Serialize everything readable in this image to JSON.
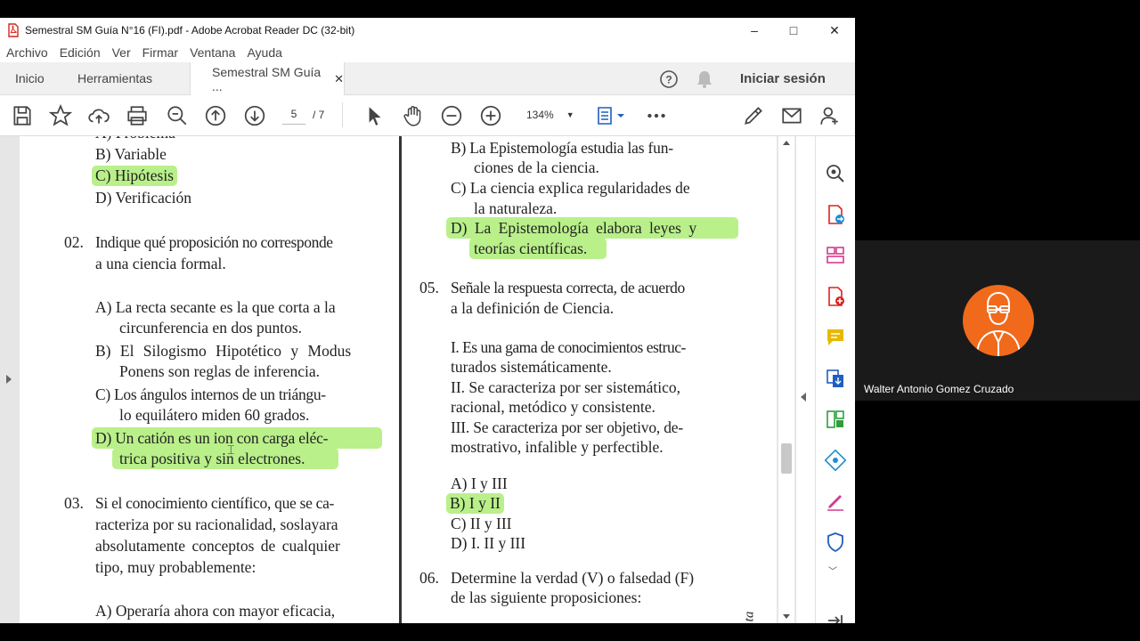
{
  "window": {
    "title": "Semestral SM Guía N°16 (FI).pdf - Adobe Acrobat Reader DC (32-bit)",
    "minimize": "–",
    "maximize": "□",
    "close": "✕"
  },
  "menu": [
    "Archivo",
    "Edición",
    "Ver",
    "Firmar",
    "Ventana",
    "Ayuda"
  ],
  "tabs": {
    "home": "Inicio",
    "tools": "Herramientas",
    "doc": "Semestral SM Guía ...",
    "signin": "Iniciar sesión"
  },
  "toolbar": {
    "page_current": "5",
    "page_total": "/ 7",
    "zoom": "134%"
  },
  "doc": {
    "l0": "A) Problema",
    "l1": "B) Variable",
    "l2": "C) Hipótesis",
    "l3": "D) Verificación",
    "q02_num": "02.",
    "q02_a": "Indique qué proposición no corresponde",
    "q02_b": "a una ciencia formal.",
    "q02_A1": "A) La recta secante es la que corta a la",
    "q02_A2": "circunferencia en dos puntos.",
    "q02_B1": "B) El Silogismo Hipotético y Modus",
    "q02_B2": "Ponens son reglas de inferencia.",
    "q02_C1": "C)  Los ángulos internos de un triángu-",
    "q02_C2": "lo equilátero miden 60 grados.",
    "q02_D1": "D) Un catión es un ion con carga eléc-",
    "q02_D2": "trica positiva y sin electrones.",
    "q03_num": "03.",
    "q03_a": "Si el conocimiento científico, que se ca-",
    "q03_b": "racteriza por su racionalidad, soslayara",
    "q03_c": "absolutamente conceptos de cualquier",
    "q03_d": "tipo, muy probablemente:",
    "q03_A": "A) Operaría ahora con mayor eficacia,",
    "r_B1": "B) La Epistemología estudia las fun-",
    "r_B2": "ciones de la ciencia.",
    "r_C1": "C) La ciencia explica regularidades de",
    "r_C2": "la naturaleza.",
    "r_D1": "D) La Epistemología elabora leyes y",
    "r_D2": "teorías científicas.",
    "q05_num": "05.",
    "q05_a": "Señale la respuesta correcta, de acuerdo",
    "q05_b": "a la definición de Ciencia.",
    "q05_I1": "I. Es una gama de conocimientos estruc-",
    "q05_I2": "turados sistemáticamente.",
    "q05_II1": "II. Se caracteriza por ser sistemático,",
    "q05_II2": "racional, metódico y consistente.",
    "q05_III1": "III. Se caracteriza por ser objetivo, de-",
    "q05_III2": "mostrativo, infalible y perfectible.",
    "q05_A": "A) I y III",
    "q05_B": "B) I y II",
    "q05_C": "C) II y III",
    "q05_D": "D) I. II y III",
    "q06_num": "06.",
    "q06_a": "Determine la verdad (V) o falsedad (F)",
    "q06_b": "de las siguiente proposiciones:",
    "edge": "ta"
  },
  "participant": {
    "name": "Walter Antonio Gomez Cruzado"
  },
  "colors": {
    "highlight": "#b9f08a",
    "acrobat_red": "#d7251d",
    "toolbar_green": "#2e9e3a",
    "avatar": "#f16a1c"
  }
}
